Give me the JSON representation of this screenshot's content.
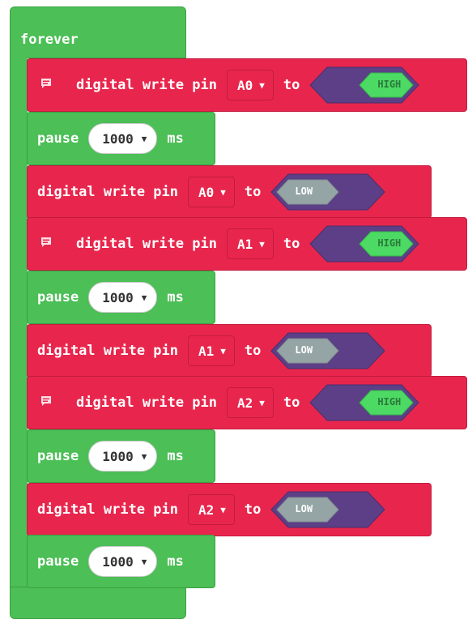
{
  "loop": {
    "label": "forever"
  },
  "write_label": "digital write pin",
  "to_label": "to",
  "pause_label": "pause",
  "ms_label": "ms",
  "blocks": [
    {
      "kind": "write",
      "pin": "A0",
      "value": "HIGH",
      "comment": true
    },
    {
      "kind": "pause",
      "ms": "1000"
    },
    {
      "kind": "write",
      "pin": "A0",
      "value": "LOW",
      "comment": false
    },
    {
      "kind": "write",
      "pin": "A1",
      "value": "HIGH",
      "comment": true
    },
    {
      "kind": "pause",
      "ms": "1000"
    },
    {
      "kind": "write",
      "pin": "A1",
      "value": "LOW",
      "comment": false
    },
    {
      "kind": "write",
      "pin": "A2",
      "value": "HIGH",
      "comment": true
    },
    {
      "kind": "pause",
      "ms": "1000"
    },
    {
      "kind": "write",
      "pin": "A2",
      "value": "LOW",
      "comment": false
    },
    {
      "kind": "pause",
      "ms": "1000"
    }
  ],
  "colors": {
    "write_block": "#e8264d",
    "pause_block": "#4cbf56",
    "toggle_track": "#5c3f86",
    "high_thumb": "#4cd964",
    "low_thumb": "#95a5a6"
  },
  "icons": {
    "comment": "comment-icon",
    "dropdown": "dropdown-caret-icon"
  }
}
